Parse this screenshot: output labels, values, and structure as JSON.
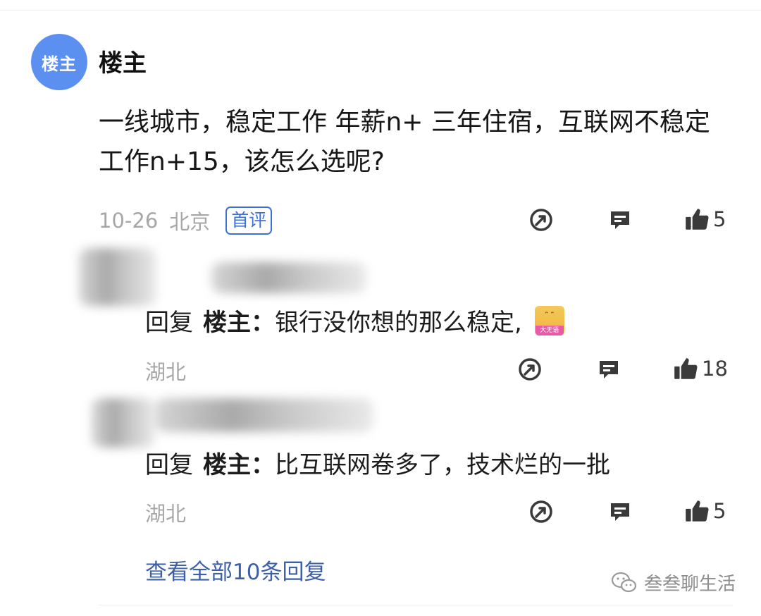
{
  "post": {
    "avatar_text": "楼主",
    "author": "楼主",
    "content": "一线城市，稳定工作 年薪n+ 三年住宿，互联网不稳定工作n+15，该怎么选呢?",
    "date": "10-26",
    "location": "北京",
    "badge": "首评",
    "likes": "5"
  },
  "replies": [
    {
      "prefix": "回复",
      "target": "楼主：",
      "text": "银行没你想的那么稳定,",
      "sticker_label": "大无语",
      "location": "湖北",
      "likes": "18"
    },
    {
      "prefix": "回复",
      "target": "楼主：",
      "text": "比互联网卷多了，技术烂的一批",
      "location": "湖北",
      "likes": "5"
    }
  ],
  "view_all": "查看全部10条回复",
  "watermark": "叁叁聊生活",
  "icons": {
    "share": "share-icon",
    "comment": "comment-icon",
    "like": "thumbs-up-icon",
    "wechat": "wechat-icon"
  },
  "colors": {
    "avatar": "#5b8ff0",
    "badge": "#3d6fd6",
    "link": "#3c5fa8",
    "meta": "#a7a7a7"
  }
}
